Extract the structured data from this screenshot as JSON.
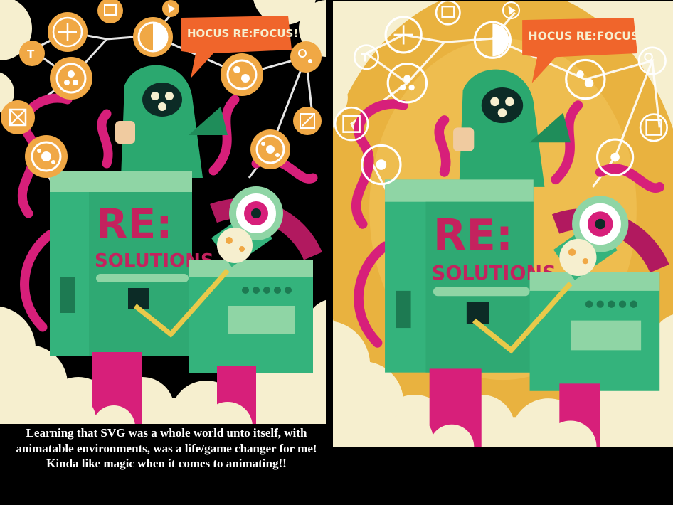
{
  "caption": "Learning that SVG was a whole world unto itself, with animatable environments, was a life/game changer for me! Kinda like magic when it comes to animating!!",
  "illustration": {
    "speech_bubble": "HOCUS RE:FOCUS!",
    "logo_line1": "RE:",
    "logo_line2": "SOLUTIONS"
  },
  "colors": {
    "left_background": "#000000",
    "right_background": "#e9b23f",
    "machine_green": "#34b37c",
    "machine_light": "#8fd5a5",
    "tentacle_pink": "#d71f7a",
    "orange": "#f0a845",
    "bubble_orange": "#f0652b",
    "cloud_cream": "#f6efcf"
  },
  "icons": [
    "move-icon",
    "text-icon",
    "transform-icon",
    "circles-icon",
    "contrast-icon",
    "fill-icon",
    "pointer-icon",
    "shape-icon",
    "curve-icon",
    "edit-icon",
    "hand-icon"
  ]
}
